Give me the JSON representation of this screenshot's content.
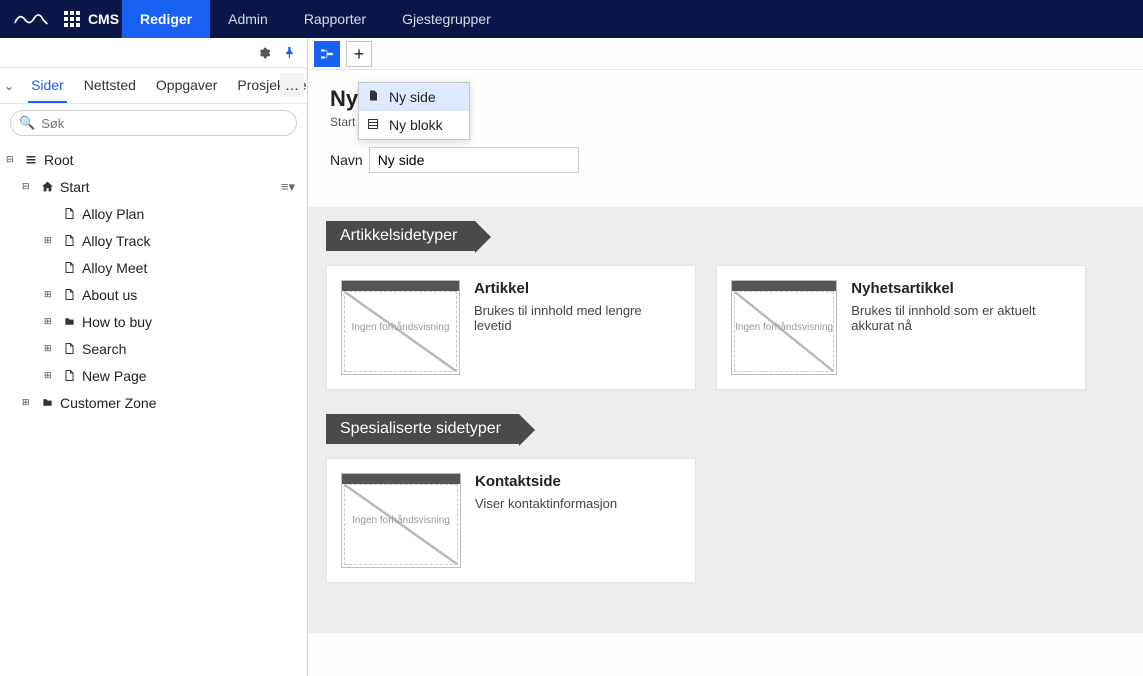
{
  "topnav": {
    "brand": "CMS",
    "tabs": [
      {
        "label": "Rediger",
        "active": true
      },
      {
        "label": "Admin",
        "active": false
      },
      {
        "label": "Rapporter",
        "active": false
      },
      {
        "label": "Gjestegrupper",
        "active": false
      }
    ]
  },
  "left": {
    "tabs": [
      {
        "label": "Sider",
        "active": true
      },
      {
        "label": "Nettsted",
        "active": false
      },
      {
        "label": "Oppgaver",
        "active": false
      },
      {
        "label": "Prosjektele",
        "active": false
      }
    ],
    "search_placeholder": "Søk",
    "tree": [
      {
        "label": "Root",
        "icon": "list",
        "exp": "–",
        "level": 0
      },
      {
        "label": "Start",
        "icon": "home",
        "exp": "–",
        "level": 1,
        "menu": true
      },
      {
        "label": "Alloy Plan",
        "icon": "page",
        "exp": "",
        "level": 2
      },
      {
        "label": "Alloy Track",
        "icon": "page",
        "exp": "+",
        "level": 2
      },
      {
        "label": "Alloy Meet",
        "icon": "page",
        "exp": "",
        "level": 2
      },
      {
        "label": "About us",
        "icon": "page",
        "exp": "+",
        "level": 2
      },
      {
        "label": "How to buy",
        "icon": "folder",
        "exp": "+",
        "level": 2
      },
      {
        "label": "Search",
        "icon": "page",
        "exp": "+",
        "level": 2
      },
      {
        "label": "New Page",
        "icon": "page",
        "exp": "+",
        "level": 2
      },
      {
        "label": "Customer Zone",
        "icon": "folder",
        "exp": "+",
        "level": 1
      }
    ]
  },
  "dropdown": {
    "items": [
      {
        "label": "Ny side",
        "icon": "page",
        "selected": true
      },
      {
        "label": "Ny blokk",
        "icon": "block",
        "selected": false
      }
    ]
  },
  "form": {
    "title_visible": "Ny",
    "crumb": "Start",
    "name_label": "Navn",
    "name_value": "Ny side"
  },
  "categories": [
    {
      "label": "Artikkelsidetyper",
      "cards": [
        {
          "title": "Artikkel",
          "desc": "Brukes til innhold med lengre levetid",
          "thumb": "Ingen forhåndsvisning"
        },
        {
          "title": "Nyhetsartikkel",
          "desc": "Brukes til innhold som er aktuelt akkurat nå",
          "thumb": "Ingen forhåndsvisning"
        }
      ]
    },
    {
      "label": "Spesialiserte sidetyper",
      "cards": [
        {
          "title": "Kontaktside",
          "desc": "Viser kontaktinformasjon",
          "thumb": "Ingen forhåndsvisning"
        }
      ]
    }
  ]
}
